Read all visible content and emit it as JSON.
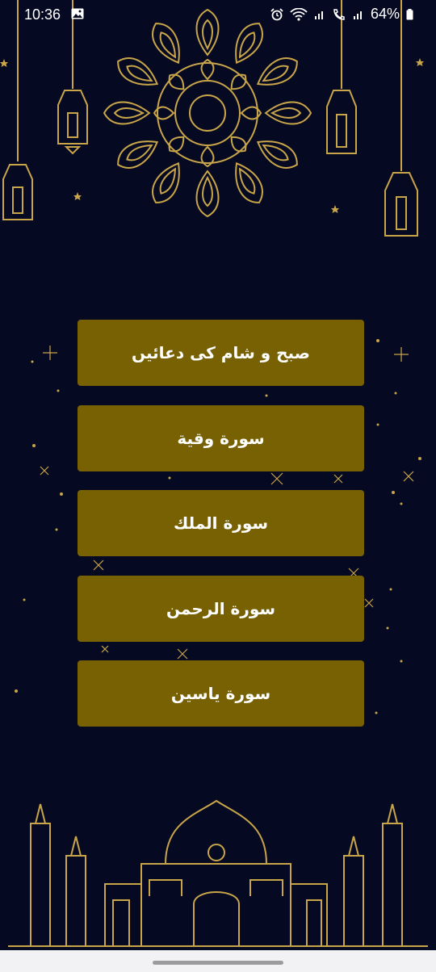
{
  "status_bar": {
    "time": "10:36",
    "battery": "64%",
    "icons": [
      "image-icon",
      "alarm-icon",
      "wifi-icon",
      "signal-icon",
      "wifi-calling-icon",
      "signal-icon",
      "battery-icon"
    ]
  },
  "menu": {
    "items": [
      {
        "label": "صبح و شام کی دعائیں"
      },
      {
        "label": "سورة وقية"
      },
      {
        "label": "سورة الملك"
      },
      {
        "label": "سورة الرحمن"
      },
      {
        "label": "سورة ياسين"
      }
    ]
  },
  "colors": {
    "background": "#050a22",
    "button": "#776103",
    "gold": "#c9a54a",
    "text": "#ffffff"
  }
}
